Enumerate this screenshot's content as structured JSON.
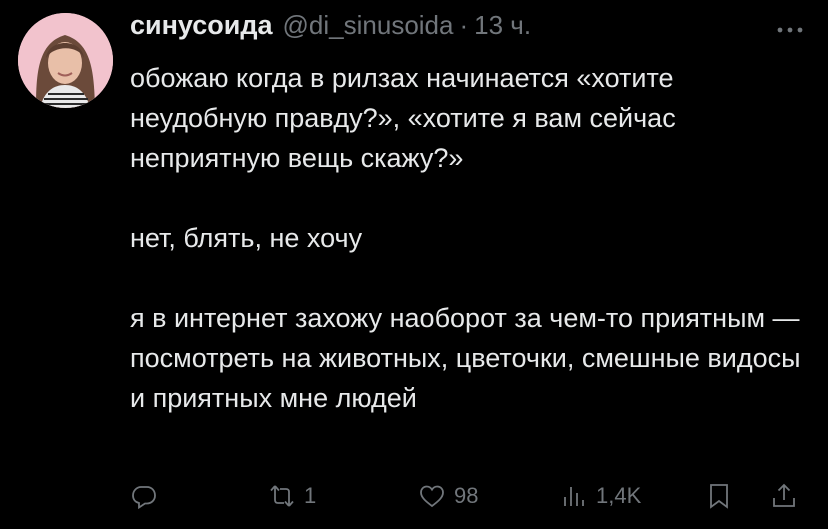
{
  "tweet": {
    "author_name": "синусоида",
    "handle": "@di_sinusoida",
    "separator": "·",
    "time": "13 ч.",
    "paragraphs": [
      "обожаю когда в рилзах начинается «хотите неудобную правду?», «хотите я вам сейчас неприятную вещь скажу?»",
      "нет, блять, не хочу",
      "я в интернет захожу наоборот за чем-то приятным — посмотреть на животных, цветочки, смешные видосы и приятных мне людей"
    ]
  },
  "actions": {
    "retweet_count": "1",
    "like_count": "98",
    "views_count": "1,4K"
  },
  "icons": [
    "more-icon",
    "reply-icon",
    "retweet-icon",
    "like-icon",
    "views-icon",
    "bookmark-icon",
    "share-icon"
  ],
  "colors": {
    "background": "#000000",
    "text": "#e7e9ea",
    "secondary": "#71767b"
  }
}
